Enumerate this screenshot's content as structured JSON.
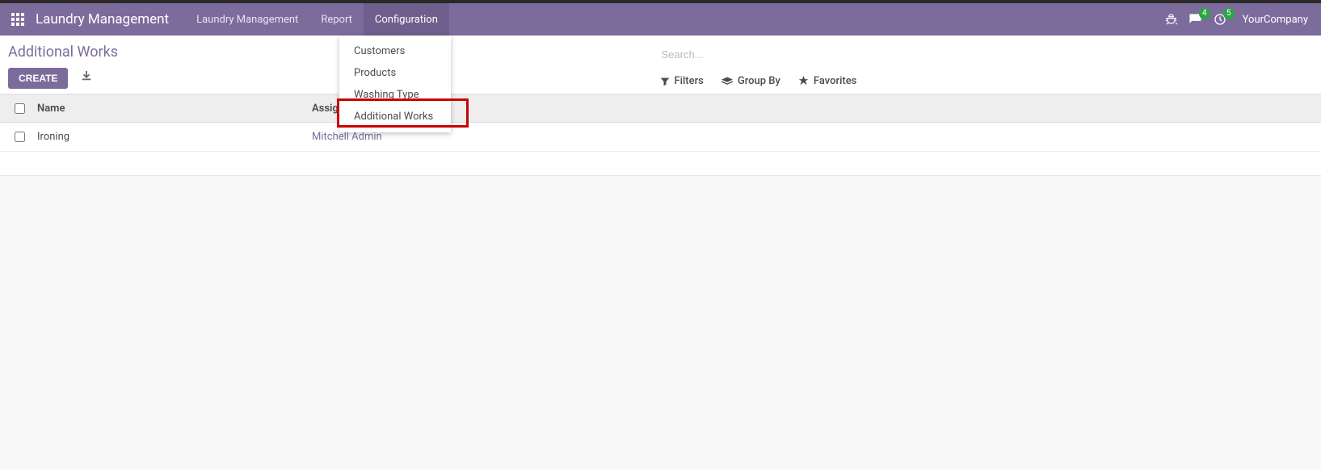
{
  "navbar": {
    "app_title": "Laundry Management",
    "menu": {
      "laundry": "Laundry Management",
      "report": "Report",
      "configuration": "Configuration"
    },
    "right": {
      "messages_badge": "4",
      "activities_badge": "5",
      "company": "YourCompany"
    }
  },
  "config_dropdown": {
    "customers": "Customers",
    "products": "Products",
    "washing_type": "Washing Type",
    "additional_works": "Additional Works"
  },
  "header": {
    "page_title": "Additional Works",
    "create_label": "CREATE"
  },
  "search": {
    "placeholder": "Search...",
    "filters_label": "Filters",
    "groupby_label": "Group By",
    "favorites_label": "Favorites"
  },
  "table": {
    "columns": {
      "name": "Name",
      "assigned": "Assigned Person"
    },
    "rows": [
      {
        "name": "Ironing",
        "assigned": "Mitchell Admin"
      }
    ]
  }
}
